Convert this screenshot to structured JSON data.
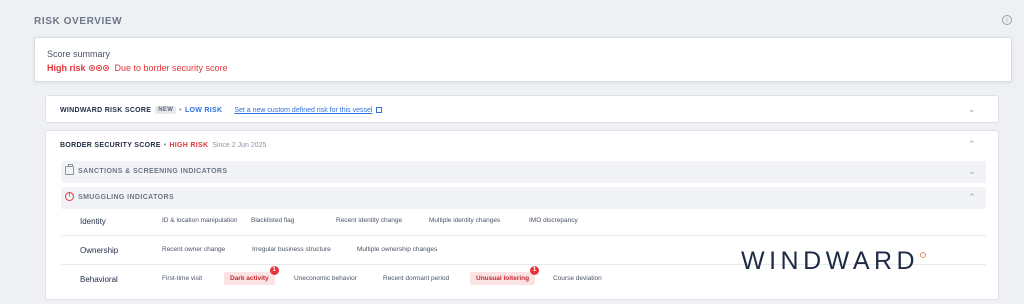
{
  "page": {
    "title": "RISK OVERVIEW"
  },
  "icons": {
    "info": "info-icon",
    "external": "external-link-icon",
    "chevron_down": "chevron-down-icon",
    "chevron_up": "chevron-up-icon",
    "warning": "warning-icon",
    "briefcase": "briefcase-icon"
  },
  "summary": {
    "title": "Score summary",
    "risk_level": "High risk",
    "risk_dots": 3,
    "reason": "Due to border security score"
  },
  "windward_score": {
    "label": "WINDWARD RISK SCORE",
    "badge": "NEW",
    "separator": "•",
    "level": "LOW RISK",
    "link": "Set a new custom defined risk for this vessel",
    "expanded": false
  },
  "border_score": {
    "label": "BORDER SECURITY SCORE",
    "separator": "•",
    "level": "HIGH RISK",
    "since": "Since 2 Jun 2025",
    "expanded": true,
    "sanctions": {
      "label": "SANCTIONS & SCREENING INDICATORS",
      "expanded": false
    },
    "smuggling": {
      "label": "SMUGGLING INDICATORS",
      "expanded": true
    },
    "rows": [
      {
        "category": "Identity",
        "indicators": [
          "ID & location manipulation",
          "Blacklisted flag",
          "Recent identity change",
          "Multiple identity changes",
          "IMO discrepancy"
        ]
      },
      {
        "category": "Ownership",
        "indicators": [
          "Recent owner change",
          "Irregular business structure",
          "Multiple ownership changes"
        ]
      },
      {
        "category": "Behavioral",
        "indicators": [
          "First-time visit",
          "Dark activity",
          "Uneconomic behavior",
          "Recent dormant period",
          "Unusual loitering",
          "Course deviation"
        ],
        "active": {
          "dark_activity_count": "1",
          "unusual_loitering_count": "1"
        }
      }
    ]
  },
  "brand": {
    "logo_text": "WINDWARD"
  },
  "colors": {
    "high_risk": "#e2363c",
    "low_risk": "#2f6fe0",
    "navy": "#1f2a44"
  }
}
